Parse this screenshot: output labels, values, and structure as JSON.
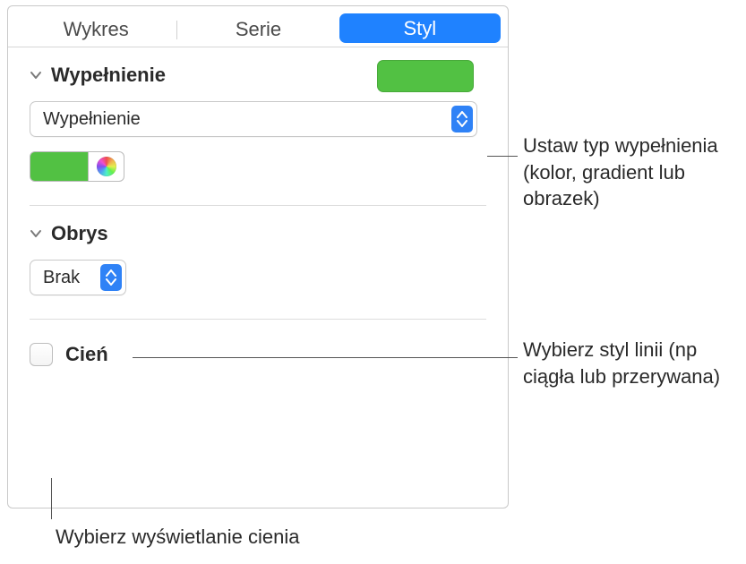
{
  "tabs": {
    "chart": "Wykres",
    "series": "Serie",
    "style": "Styl"
  },
  "fill": {
    "section_title": "Wypełnienie",
    "popup_value": "Wypełnienie",
    "preview_color": "#52c143"
  },
  "stroke": {
    "section_title": "Obrys",
    "popup_value": "Brak"
  },
  "shadow": {
    "label": "Cień"
  },
  "callouts": {
    "fill": "Ustaw typ wypełnienia (kolor, gradient lub obrazek)",
    "stroke": "Wybierz styl linii (np ciągła lub przerywana)",
    "shadow": "Wybierz wyświetlanie cienia"
  }
}
